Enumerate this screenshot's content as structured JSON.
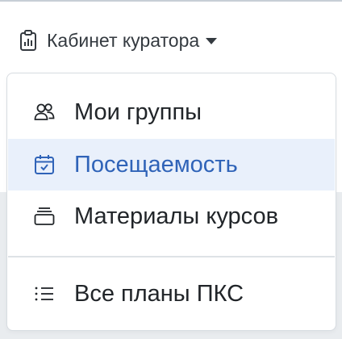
{
  "colors": {
    "accent": "#2f63b8",
    "active_background": "#e9f0fb",
    "text": "#212529"
  },
  "header": {
    "menu_label": "Кабинет куратора",
    "menu_icon": "clipboard-chart-icon"
  },
  "dropdown": {
    "items": [
      {
        "label": "Мои группы",
        "icon": "users-icon",
        "active": false
      },
      {
        "label": "Посещаемость",
        "icon": "calendar-check-icon",
        "active": true
      },
      {
        "label": "Материалы курсов",
        "icon": "stacked-folders-icon",
        "active": false
      }
    ],
    "footer_items": [
      {
        "label": "Все планы ПКС",
        "icon": "list-icon"
      }
    ]
  }
}
